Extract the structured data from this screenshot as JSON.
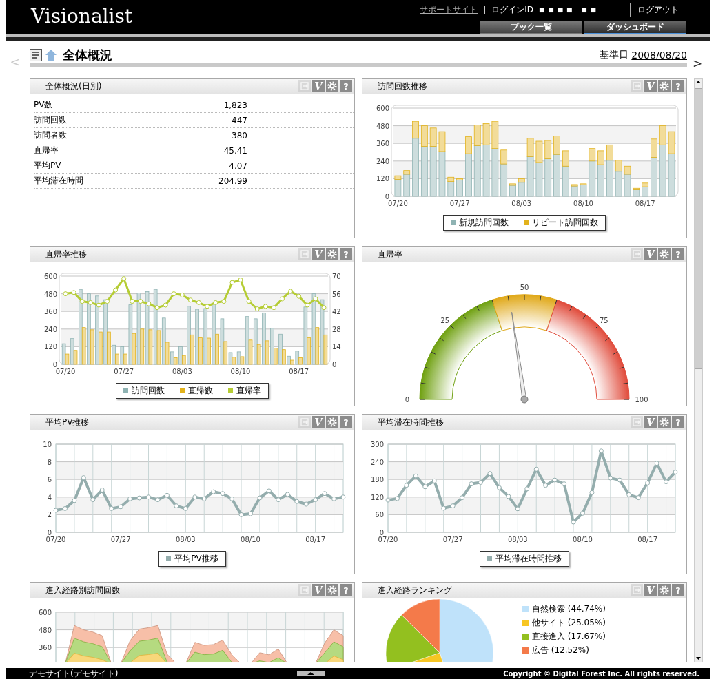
{
  "header": {
    "logo": "Visionalist",
    "support_link": "サポートサイト",
    "separator": "|",
    "login_label": "ログインID",
    "login_id": "■ ■ ■ ■   ■ ■",
    "logout": "ログアウト",
    "tabs": [
      {
        "label": "ブック一覧",
        "selected": false
      },
      {
        "label": "ダッシュボード",
        "selected": true
      }
    ]
  },
  "page": {
    "prev": "<",
    "title": "全体概況",
    "date_label": "基準日",
    "date": "2008/08/20",
    "next": ">"
  },
  "panels": [
    {
      "kind": "table",
      "title": "全体概況(日別)",
      "tools": [
        {
          "kind": "export",
          "disabled": true
        },
        {
          "kind": "brand",
          "label": "V",
          "disabled": false
        },
        {
          "kind": "settings",
          "disabled": false
        },
        {
          "kind": "help",
          "label": "?",
          "disabled": false
        }
      ],
      "rows": [
        {
          "label": "PV数",
          "value": "1,823"
        },
        {
          "label": "訪問回数",
          "value": "447"
        },
        {
          "label": "訪問者数",
          "value": "380"
        },
        {
          "label": "直帰率",
          "value": "45.41"
        },
        {
          "label": "平均PV",
          "value": "4.07"
        },
        {
          "label": "平均滞在時間",
          "value": "204.99"
        }
      ]
    },
    {
      "kind": "chart",
      "title": "訪問回数推移",
      "tools": [
        {
          "kind": "export",
          "disabled": true
        },
        {
          "kind": "brand",
          "label": "V",
          "disabled": false
        },
        {
          "kind": "settings",
          "disabled": false
        },
        {
          "kind": "help",
          "label": "?",
          "disabled": false
        }
      ],
      "chart_data": {
        "type": "bar",
        "stacked": true,
        "grid": true,
        "ylim": [
          0,
          600
        ],
        "yticks": [
          0,
          120,
          240,
          360,
          480,
          600
        ],
        "categories": [
          "07/20",
          null,
          null,
          null,
          null,
          null,
          null,
          "07/27",
          null,
          null,
          null,
          null,
          null,
          null,
          "08/03",
          null,
          null,
          null,
          null,
          null,
          null,
          "08/10",
          null,
          null,
          null,
          null,
          null,
          null,
          "08/17",
          null,
          null,
          null
        ],
        "series": [
          {
            "name": "新規訪問回数",
            "color": "#8fb3b3",
            "values": [
              115,
              150,
              395,
              340,
              340,
              305,
              100,
              110,
              290,
              345,
              350,
              325,
              220,
              75,
              95,
              270,
              230,
              255,
              285,
              205,
              70,
              78,
              240,
              215,
              245,
              170,
              150,
              45,
              65,
              265,
              350,
              290
            ]
          },
          {
            "name": "リピート訪問回数",
            "color": "#e2b21c",
            "values": [
              25,
              25,
              115,
              140,
              125,
              135,
              30,
              10,
              115,
              140,
              145,
              185,
              95,
              10,
              25,
              125,
              145,
              125,
              125,
              105,
              10,
              7,
              85,
              95,
              105,
              75,
              55,
              10,
              25,
              125,
              130,
              150
            ]
          }
        ]
      }
    },
    {
      "kind": "chart",
      "title": "直帰率推移",
      "tools": [
        {
          "kind": "export",
          "disabled": true
        },
        {
          "kind": "brand",
          "label": "V",
          "disabled": false
        },
        {
          "kind": "settings",
          "disabled": false
        },
        {
          "kind": "help",
          "label": "?",
          "disabled": false
        }
      ],
      "chart_data": {
        "type": "bar",
        "grid": true,
        "ylim": [
          0,
          600
        ],
        "yticks": [
          0,
          120,
          240,
          360,
          480,
          600
        ],
        "y2lim": [
          0,
          70
        ],
        "y2ticks": [
          0,
          14,
          28,
          42,
          56,
          70
        ],
        "categories": [
          "07/20",
          null,
          null,
          null,
          null,
          null,
          null,
          "07/27",
          null,
          null,
          null,
          null,
          null,
          null,
          "08/03",
          null,
          null,
          null,
          null,
          null,
          null,
          "08/10",
          null,
          null,
          null,
          null,
          null,
          null,
          "08/17",
          null,
          null,
          null
        ],
        "series": [
          {
            "name": "訪問回数",
            "type": "bar",
            "color": "#8fb3b3",
            "values": [
              140,
              175,
              510,
              480,
              465,
              440,
              130,
              120,
              405,
              485,
              495,
              510,
              315,
              85,
              120,
              395,
              375,
              380,
              410,
              310,
              80,
              85,
              325,
              310,
              350,
              245,
              205,
              55,
              90,
              390,
              480,
              440
            ]
          },
          {
            "name": "直帰数",
            "type": "bar",
            "color": "#e2b21c",
            "values": [
              70,
              95,
              250,
              235,
              220,
              220,
              70,
              70,
              210,
              240,
              235,
              230,
              150,
              45,
              60,
              200,
              180,
              178,
              205,
              155,
              48,
              52,
              165,
              135,
              160,
              110,
              100,
              28,
              45,
              180,
              250,
              200
            ]
          },
          {
            "name": "直帰率",
            "type": "line",
            "axis": "y2",
            "marker": true,
            "color": "#b5cc33",
            "values": [
              56,
              57,
              50,
              49,
              47,
              50,
              59,
              68,
              50,
              50,
              48,
              45,
              47,
              56,
              55,
              51,
              49,
              46,
              49,
              50,
              65,
              67,
              50,
              44,
              46,
              45,
              52,
              58,
              54,
              47,
              52,
              45
            ]
          }
        ]
      }
    },
    {
      "kind": "gauge",
      "title": "直帰率",
      "tools": [
        {
          "kind": "export",
          "disabled": true
        },
        {
          "kind": "brand",
          "label": "V",
          "disabled": false
        },
        {
          "kind": "settings",
          "disabled": false
        },
        {
          "kind": "help",
          "label": "?",
          "disabled": false
        }
      ],
      "level": 0.4541,
      "scale": [
        "0",
        "25",
        "50",
        "75",
        "100"
      ]
    },
    {
      "kind": "chart",
      "title": "平均PV推移",
      "tools": [
        {
          "kind": "export",
          "disabled": true
        },
        {
          "kind": "brand",
          "label": "V",
          "disabled": false
        },
        {
          "kind": "settings",
          "disabled": false
        },
        {
          "kind": "help",
          "label": "?",
          "disabled": false
        }
      ],
      "chart_data": {
        "type": "line",
        "grid": true,
        "ylim": [
          0,
          10
        ],
        "yticks": [
          0,
          2,
          4,
          6,
          8,
          10
        ],
        "categories": [
          "07/20",
          null,
          null,
          null,
          null,
          null,
          null,
          "07/27",
          null,
          null,
          null,
          null,
          null,
          null,
          "08/03",
          null,
          null,
          null,
          null,
          null,
          null,
          "08/10",
          null,
          null,
          null,
          null,
          null,
          null,
          "08/17",
          null,
          null,
          null
        ],
        "series": [
          {
            "name": "平均PV推移",
            "marker": true,
            "color": "#94adad",
            "values": [
              2.5,
              2.7,
              3.6,
              6.2,
              3.7,
              4.8,
              2.7,
              2.9,
              3.8,
              3.9,
              4.0,
              3.7,
              4.2,
              3.0,
              2.7,
              4.0,
              3.8,
              4.6,
              4.4,
              3.8,
              2.0,
              2.1,
              3.9,
              4.7,
              3.7,
              4.3,
              3.5,
              3.2,
              3.7,
              4.4,
              3.8,
              4.0
            ]
          }
        ]
      }
    },
    {
      "kind": "chart",
      "title": "平均滞在時間推移",
      "tools": [
        {
          "kind": "export",
          "disabled": true
        },
        {
          "kind": "brand",
          "label": "V",
          "disabled": false
        },
        {
          "kind": "settings",
          "disabled": false
        },
        {
          "kind": "help",
          "label": "?",
          "disabled": false
        }
      ],
      "chart_data": {
        "type": "line",
        "grid": true,
        "ylim": [
          0,
          300
        ],
        "yticks": [
          0,
          60,
          120,
          180,
          240,
          300
        ],
        "categories": [
          "07/20",
          null,
          null,
          null,
          null,
          null,
          null,
          "07/27",
          null,
          null,
          null,
          null,
          null,
          null,
          "08/03",
          null,
          null,
          null,
          null,
          null,
          null,
          "08/10",
          null,
          null,
          null,
          null,
          null,
          null,
          "08/17",
          null,
          null,
          null
        ],
        "series": [
          {
            "name": "平均滞在時間推移",
            "marker": true,
            "color": "#94adad",
            "values": [
              110,
              115,
              160,
              192,
              155,
              175,
              82,
              90,
              118,
              165,
              170,
              200,
              152,
              122,
              80,
              148,
              215,
              160,
              178,
              165,
              35,
              65,
              135,
              277,
              185,
              178,
              128,
              118,
              168,
              235,
              172,
              205
            ]
          }
        ]
      }
    },
    {
      "kind": "area",
      "title": "進入経路別訪問回数",
      "tools": [
        {
          "kind": "export",
          "disabled": true
        },
        {
          "kind": "brand",
          "label": "V",
          "disabled": false
        },
        {
          "kind": "settings",
          "disabled": false
        },
        {
          "kind": "help",
          "label": "?",
          "disabled": false
        }
      ],
      "axis_labels": [
        "600",
        "480",
        "360"
      ]
    },
    {
      "kind": "pie",
      "title": "進入経路ランキング",
      "tools": [
        {
          "kind": "export",
          "disabled": true
        },
        {
          "kind": "brand",
          "label": "V",
          "disabled": false
        },
        {
          "kind": "settings",
          "disabled": false
        },
        {
          "kind": "help",
          "label": "?",
          "disabled": false
        }
      ],
      "chart_data": {
        "type": "pie",
        "categories": [
          "自然検索 (44.74%)",
          "他サイト (25.05%)",
          "直接進入 (17.67%)",
          "広告 (12.52%)"
        ],
        "values": [
          44.74,
          25.05,
          17.67,
          12.52
        ],
        "colors": [
          "#bfe2fa",
          "#f7c623",
          "#93c01f",
          "#f47a4a"
        ]
      }
    }
  ],
  "footer": {
    "site": "デモサイト(デモサイト)",
    "copyright": "Copyright © Digital Forest Inc. All rights reserved."
  }
}
